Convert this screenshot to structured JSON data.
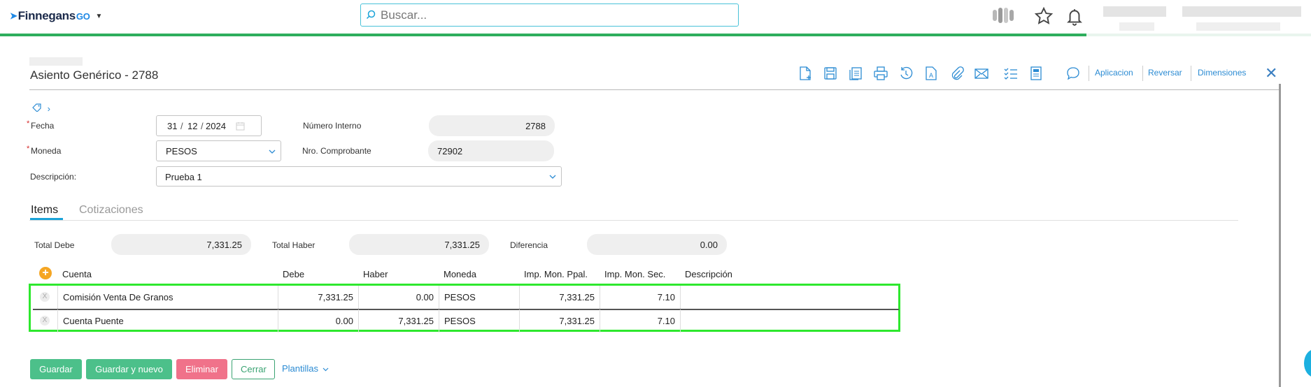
{
  "topbar": {
    "logo_text": "Finnegans",
    "logo_go": "GO",
    "search_placeholder": "Buscar..."
  },
  "header": {
    "title": "Asiento Genérico - 2788",
    "actions": [
      "Aplicacion",
      "Reversar",
      "Dimensiones"
    ]
  },
  "form": {
    "fecha_label": "Fecha",
    "fecha_day": "31",
    "fecha_month": "12",
    "fecha_year": "2024",
    "numero_interno_label": "Número Interno",
    "numero_interno_value": "2788",
    "moneda_label": "Moneda",
    "moneda_value": "PESOS",
    "nro_comprobante_label": "Nro. Comprobante",
    "nro_comprobante_value": "72902",
    "descripcion_label": "Descripción:",
    "descripcion_value": "Prueba 1"
  },
  "tabs": [
    {
      "label": "Items",
      "active": true
    },
    {
      "label": "Cotizaciones",
      "active": false
    }
  ],
  "totals": {
    "total_debe_label": "Total Debe",
    "total_debe_value": "7,331.25",
    "total_haber_label": "Total Haber",
    "total_haber_value": "7,331.25",
    "diferencia_label": "Diferencia",
    "diferencia_value": "0.00"
  },
  "grid": {
    "columns": [
      "Cuenta",
      "Debe",
      "Haber",
      "Moneda",
      "Imp. Mon. Ppal.",
      "Imp. Mon. Sec.",
      "Descripción"
    ],
    "rows": [
      {
        "cuenta": "Comisión Venta De Granos",
        "debe": "7,331.25",
        "haber": "0.00",
        "moneda": "PESOS",
        "imp_ppal": "7,331.25",
        "imp_sec": "7.10",
        "descripcion": ""
      },
      {
        "cuenta": "Cuenta Puente",
        "debe": "0.00",
        "haber": "7,331.25",
        "moneda": "PESOS",
        "imp_ppal": "7,331.25",
        "imp_sec": "7.10",
        "descripcion": ""
      }
    ],
    "delete_glyph": "X",
    "add_glyph": "+"
  },
  "buttons": {
    "guardar": "Guardar",
    "guardar_nuevo": "Guardar y nuevo",
    "eliminar": "Eliminar",
    "cerrar": "Cerrar",
    "plantillas": "Plantillas"
  },
  "colors": {
    "accent_green": "#2fae5d",
    "link_blue": "#2b8bd3",
    "highlight_green": "#2ee82e",
    "delete_red": "#f0728a"
  }
}
